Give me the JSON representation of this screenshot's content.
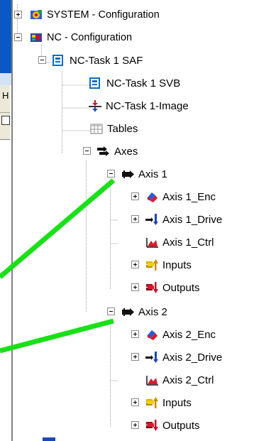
{
  "tree": {
    "system_configuration": "SYSTEM - Configuration",
    "nc_configuration": "NC - Configuration",
    "nc_task_saf": "NC-Task 1 SAF",
    "nc_task_svb": "NC-Task 1 SVB",
    "nc_task_image": "NC-Task 1-Image",
    "tables": "Tables",
    "axes": "Axes",
    "axis1": {
      "label": "Axis 1",
      "enc": "Axis 1_Enc",
      "drive": "Axis 1_Drive",
      "ctrl": "Axis 1_Ctrl",
      "inputs": "Inputs",
      "outputs": "Outputs"
    },
    "axis2": {
      "label": "Axis 2",
      "enc": "Axis 2_Enc",
      "drive": "Axis 2_Drive",
      "ctrl": "Axis 2_Ctrl",
      "inputs": "Inputs",
      "outputs": "Outputs"
    }
  },
  "background_window": {
    "toolbar_letter": "H"
  },
  "colors": {
    "annotation_green": "#19e019",
    "titlebar_blue": "#0a58c6",
    "tree_line": "#a0a0a0"
  }
}
